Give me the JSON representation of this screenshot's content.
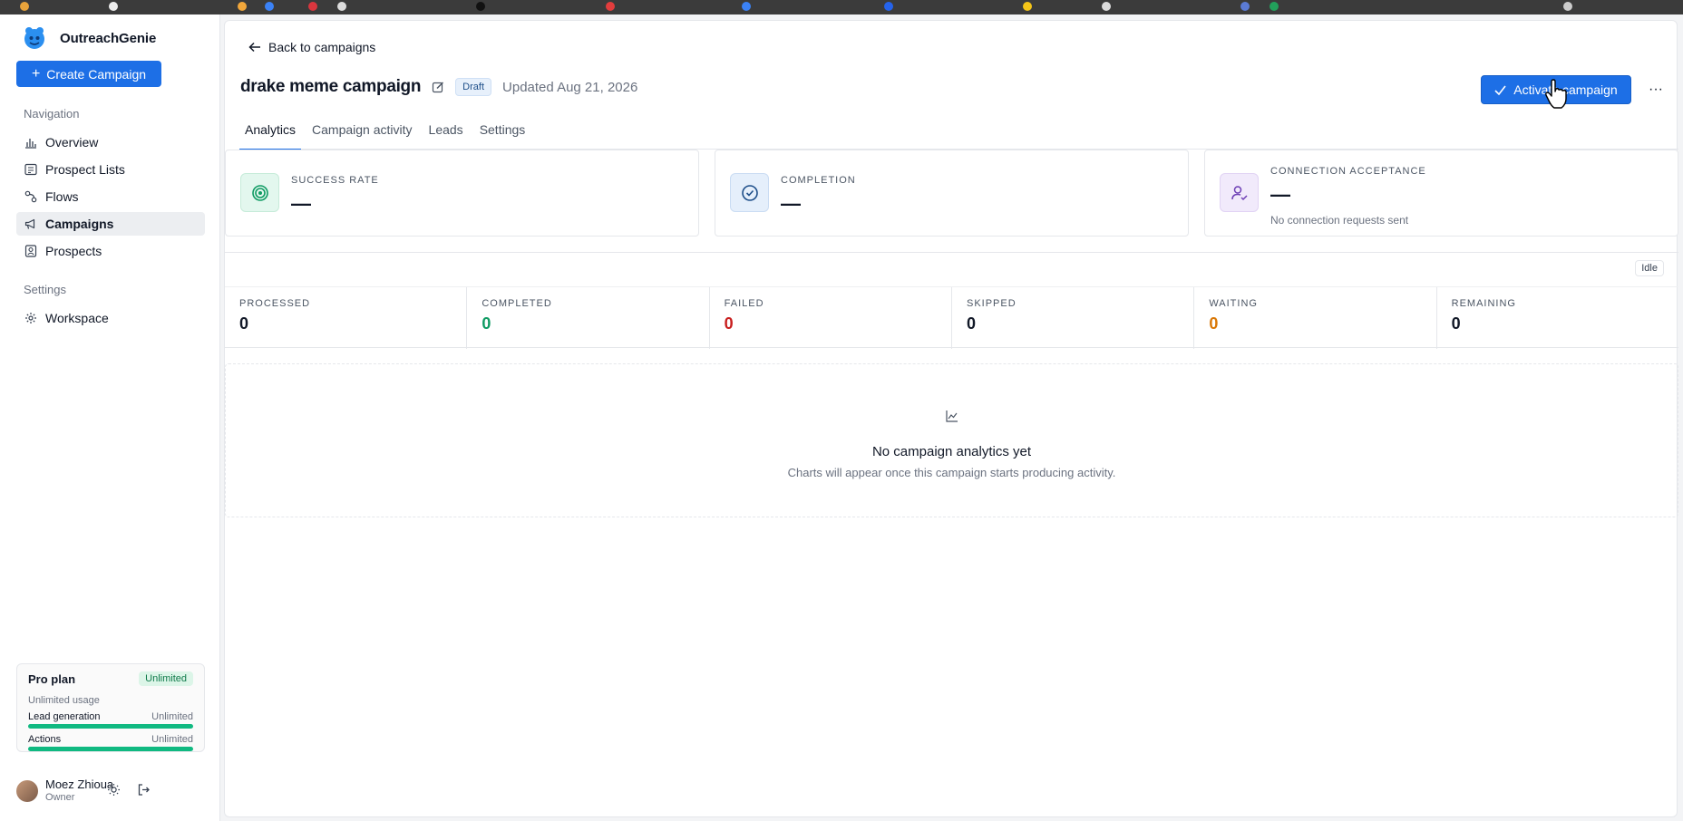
{
  "app": {
    "name": "OutreachGenie"
  },
  "sidebar": {
    "create_label": "Create Campaign",
    "nav_heading": "Navigation",
    "items": [
      {
        "label": "Overview",
        "icon": "bar-chart-icon"
      },
      {
        "label": "Prospect Lists",
        "icon": "list-icon"
      },
      {
        "label": "Flows",
        "icon": "flow-icon"
      },
      {
        "label": "Campaigns",
        "icon": "megaphone-icon",
        "active": true
      },
      {
        "label": "Prospects",
        "icon": "contact-icon"
      }
    ],
    "settings_heading": "Settings",
    "settings_items": [
      {
        "label": "Workspace",
        "icon": "gear-icon"
      }
    ],
    "plan": {
      "title": "Pro plan",
      "badge": "Unlimited",
      "subtitle": "Unlimited usage",
      "rows": [
        {
          "label": "Lead generation",
          "value": "Unlimited",
          "fill": 1.0
        },
        {
          "label": "Actions",
          "value": "Unlimited",
          "fill": 1.0
        }
      ]
    },
    "user": {
      "name": "Moez Zhioua",
      "role": "Owner"
    }
  },
  "header": {
    "back_label": "Back to campaigns",
    "title": "drake meme campaign",
    "status_badge": "Draft",
    "updated": "Updated Aug 21, 2026",
    "activate_label": "Activate campaign",
    "more_label": "···"
  },
  "tabs": [
    {
      "label": "Analytics",
      "active": true
    },
    {
      "label": "Campaign activity"
    },
    {
      "label": "Leads"
    },
    {
      "label": "Settings"
    }
  ],
  "kpis": [
    {
      "label": "SUCCESS RATE",
      "value": "—",
      "icon": "target-icon"
    },
    {
      "label": "COMPLETION",
      "value": "—",
      "icon": "check-circle-icon"
    },
    {
      "label": "CONNECTION ACCEPTANCE",
      "value": "—",
      "note": "No connection requests sent",
      "icon": "user-check-icon"
    }
  ],
  "stats": {
    "status": "Idle",
    "items": [
      {
        "label": "PROCESSED",
        "value": "0",
        "color": "#111827"
      },
      {
        "label": "COMPLETED",
        "value": "0",
        "color": "#0f9b63"
      },
      {
        "label": "FAILED",
        "value": "0",
        "color": "#c81e1e"
      },
      {
        "label": "SKIPPED",
        "value": "0",
        "color": "#111827"
      },
      {
        "label": "WAITING",
        "value": "0",
        "color": "#d97706"
      },
      {
        "label": "REMAINING",
        "value": "0",
        "color": "#111827"
      }
    ]
  },
  "empty_state": {
    "title": "No campaign analytics yet",
    "subtitle": "Charts will appear once this campaign starts producing activity.",
    "icon": "line-chart-icon"
  }
}
